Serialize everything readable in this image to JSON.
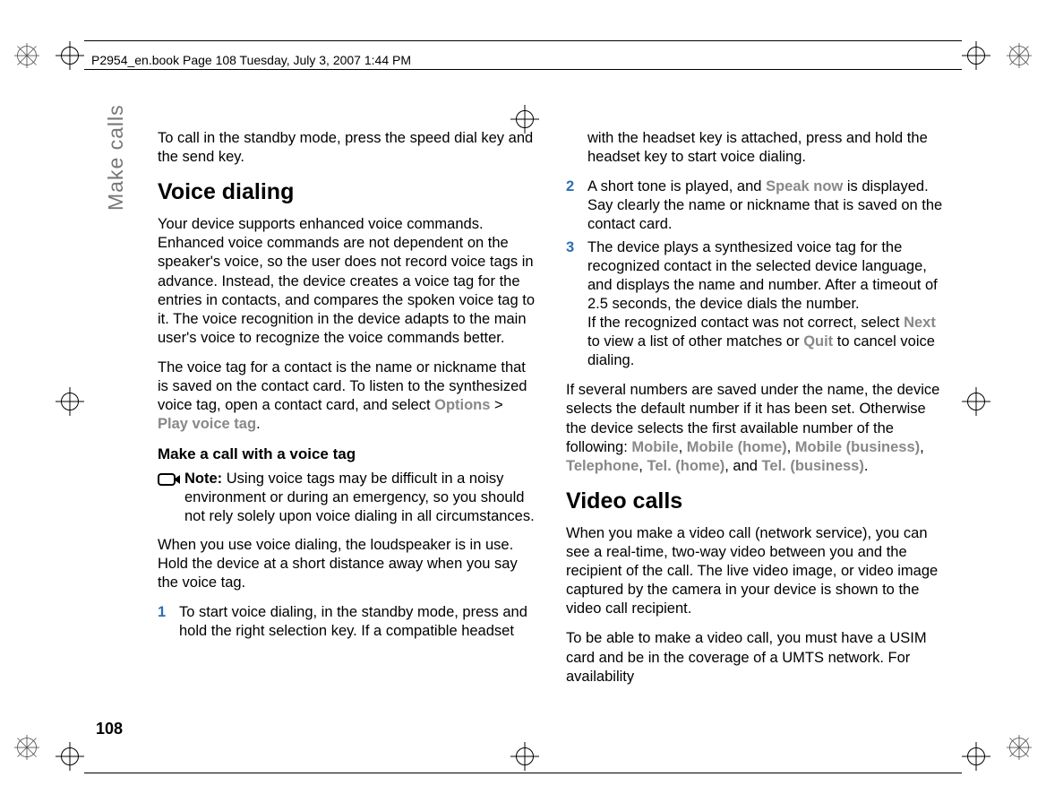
{
  "header": {
    "running": "P2954_en.book  Page 108  Tuesday, July 3, 2007  1:44 PM"
  },
  "sidebar": {
    "chapter": "Make calls"
  },
  "page_number": "108",
  "left": {
    "para1": "To call in the standby mode, press the speed dial key and the send key.",
    "h2": "Voice dialing",
    "para2": "Your device supports enhanced voice commands. Enhanced voice commands are not dependent on the speaker's voice, so the user does not record voice tags in advance. Instead, the device creates a voice tag for the entries in contacts, and compares the spoken voice tag to it. The voice recognition in the device adapts to the main user's voice to recognize the voice commands better.",
    "para3a": "The voice tag for a contact is the name or nickname that is saved on the contact card. To listen to the synthesized voice tag, open a contact card, and select ",
    "ui_options": "Options",
    "gt": " > ",
    "ui_play": "Play voice tag",
    "period": ".",
    "h3": "Make a call with a voice tag",
    "note_label": "Note:",
    "note_text": " Using voice tags may be difficult in a noisy environment or during an emergency, so you should not rely solely upon voice dialing in all circumstances.",
    "para4": "When you use voice dialing, the loudspeaker is in use. Hold the device at a short distance away when you say the voice tag.",
    "step1_num": "1",
    "step1": "To start voice dialing, in the standby mode, press and hold the right selection key. If a compatible headset"
  },
  "right": {
    "cont1": "with the headset key is attached, press and hold the headset key to start voice dialing.",
    "step2_num": "2",
    "step2a": "A short tone is played, and ",
    "ui_speak": "Speak now",
    "step2b": " is displayed. Say clearly the name or nickname that is saved on the contact card.",
    "step3_num": "3",
    "step3a": "The device plays a synthesized voice tag for the recognized contact in the selected device language, and displays the name and number. After a timeout of 2.5 seconds, the device dials the number.",
    "step3b_a": "If the recognized contact was not correct, select ",
    "ui_next": "Next",
    "step3b_b": " to view a list of other matches or ",
    "ui_quit": "Quit",
    "step3b_c": " to cancel voice dialing.",
    "para5a": "If several numbers are saved under the name, the device selects the default number if it has been set. Otherwise the device selects the first available number of the following: ",
    "ui_mobile": "Mobile",
    "comma": ", ",
    "ui_mobile_home": "Mobile (home)",
    "ui_mobile_biz": "Mobile (business)",
    "ui_tel": "Telephone",
    "ui_tel_home": "Tel. (home)",
    "and": ", and ",
    "ui_tel_biz": "Tel. (business)",
    "h2": "Video calls",
    "para6": "When you make a video call (network service), you can see a real-time, two-way video between you and the recipient of the call. The live video image, or video image captured by the camera in your device is shown to the video call recipient.",
    "para7": "To be able to make a video call, you must have a USIM card and be in the coverage of a UMTS network. For availability"
  }
}
